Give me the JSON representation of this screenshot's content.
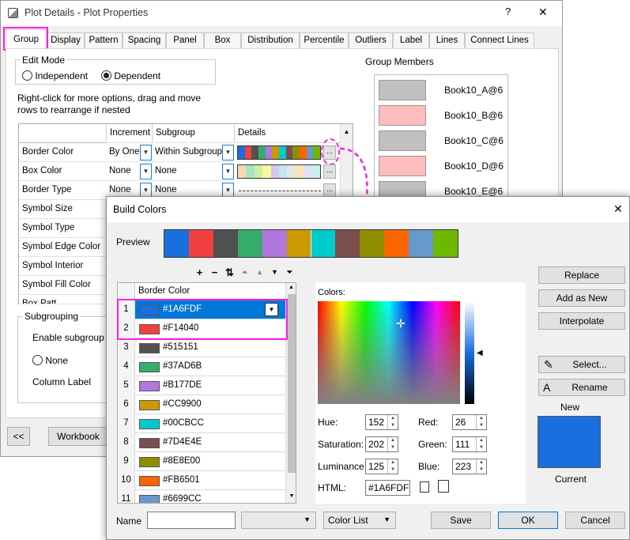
{
  "plot_details": {
    "title": "Plot Details - Plot Properties",
    "help": "?",
    "close": "✕",
    "tabs": [
      "Group",
      "Display",
      "Pattern",
      "Spacing",
      "Panel",
      "Box",
      "Distribution",
      "Percentile",
      "Outliers",
      "Label",
      "Lines",
      "Connect Lines"
    ],
    "edit_mode": {
      "label": "Edit Mode",
      "independent": "Independent",
      "dependent": "Dependent"
    },
    "hint": "Right-click for more options, drag and move rows to  rearrange if nested",
    "grid_headers": [
      "Increment",
      "Subgroup",
      "Details"
    ],
    "grid_rows": [
      {
        "name": "Border Color",
        "increment": "By One",
        "subgroup": "Within Subgroup",
        "details": "colors"
      },
      {
        "name": "Box Color",
        "increment": "None",
        "subgroup": "None",
        "details": "pastels"
      },
      {
        "name": "Border Type",
        "increment": "None",
        "subgroup": "None",
        "details": "lines"
      },
      {
        "name": "Symbol Size"
      },
      {
        "name": "Symbol Type"
      },
      {
        "name": "Symbol Edge Color"
      },
      {
        "name": "Symbol Interior"
      },
      {
        "name": "Symbol Fill Color"
      },
      {
        "name": "Box Patt..."
      }
    ],
    "ellipsis": "...",
    "group_members_label": "Group Members",
    "group_members": [
      {
        "name": "Book10_A@6",
        "color": "#c0c0c0"
      },
      {
        "name": "Book10_B@6",
        "color": "#ffbcbc"
      },
      {
        "name": "Book10_C@6",
        "color": "#c0c0c0"
      },
      {
        "name": "Book10_D@6",
        "color": "#ffbcbc"
      },
      {
        "name": "Book10_E@6",
        "color": "#c0c0c0"
      }
    ],
    "subgrouping": {
      "label": "Subgrouping",
      "enable": "Enable subgroup",
      "none": "None",
      "column_label": "Column Label"
    },
    "prev_button": "<<",
    "workbook_button": "Workbook",
    "detail_colors": [
      "#1A6FDF",
      "#F14040",
      "#515151",
      "#37AD6B",
      "#B177DE",
      "#CC9900",
      "#00CBCC",
      "#7D4E4E",
      "#8E8E00",
      "#FB6501",
      "#6699CC",
      "#6FB802",
      "#515151",
      "#37AD6B",
      "#B177DE"
    ],
    "detail_pastels": [
      "#f6d9b0",
      "#a8e6c1",
      "#c9f0a8",
      "#f7f7a0",
      "#d8c4f0",
      "#bfe8f2",
      "#e6e6e6",
      "#ffe4b5",
      "#e0e0ff",
      "#c8f0ec"
    ]
  },
  "build_colors": {
    "title": "Build Colors",
    "close": "✕",
    "preview_label": "Preview",
    "preview_colors": [
      "#1A6FDF",
      "#F14040",
      "#515151",
      "#37AD6B",
      "#B177DE",
      "#CC9900",
      "#00CBCC",
      "#7D4E4E",
      "#8E8E00",
      "#FB6501",
      "#6699CC",
      "#6FB802"
    ],
    "list_header": "Border Color",
    "rows": [
      {
        "n": "1",
        "hex": "#1A6FDF"
      },
      {
        "n": "2",
        "hex": "#F14040"
      },
      {
        "n": "3",
        "hex": "#515151"
      },
      {
        "n": "4",
        "hex": "#37AD6B"
      },
      {
        "n": "5",
        "hex": "#B177DE"
      },
      {
        "n": "6",
        "hex": "#CC9900"
      },
      {
        "n": "7",
        "hex": "#00CBCC"
      },
      {
        "n": "8",
        "hex": "#7D4E4E"
      },
      {
        "n": "9",
        "hex": "#8E8E00"
      },
      {
        "n": "10",
        "hex": "#FB6501"
      },
      {
        "n": "11",
        "hex": "#6699CC"
      }
    ],
    "colors_label": "Colors:",
    "hue_label": "Hue:",
    "hue": "152",
    "sat_label": "Saturation:",
    "sat": "202",
    "lum_label": "Luminance:",
    "lum": "125",
    "red_label": "Red:",
    "red": "26",
    "green_label": "Green:",
    "green": "111",
    "blue_label": "Blue:",
    "blue": "223",
    "html_label": "HTML:",
    "html": "#1A6FDF",
    "replace": "Replace",
    "add_as_new": "Add as New",
    "interpolate": "Interpolate",
    "select": "Select...",
    "rename": "Rename",
    "new_label": "New",
    "current_label": "Current",
    "current_color": "#1A6FDF",
    "name_label": "Name",
    "name_value": "",
    "color_list": "Color List",
    "save": "Save",
    "ok": "OK",
    "cancel": "Cancel"
  }
}
